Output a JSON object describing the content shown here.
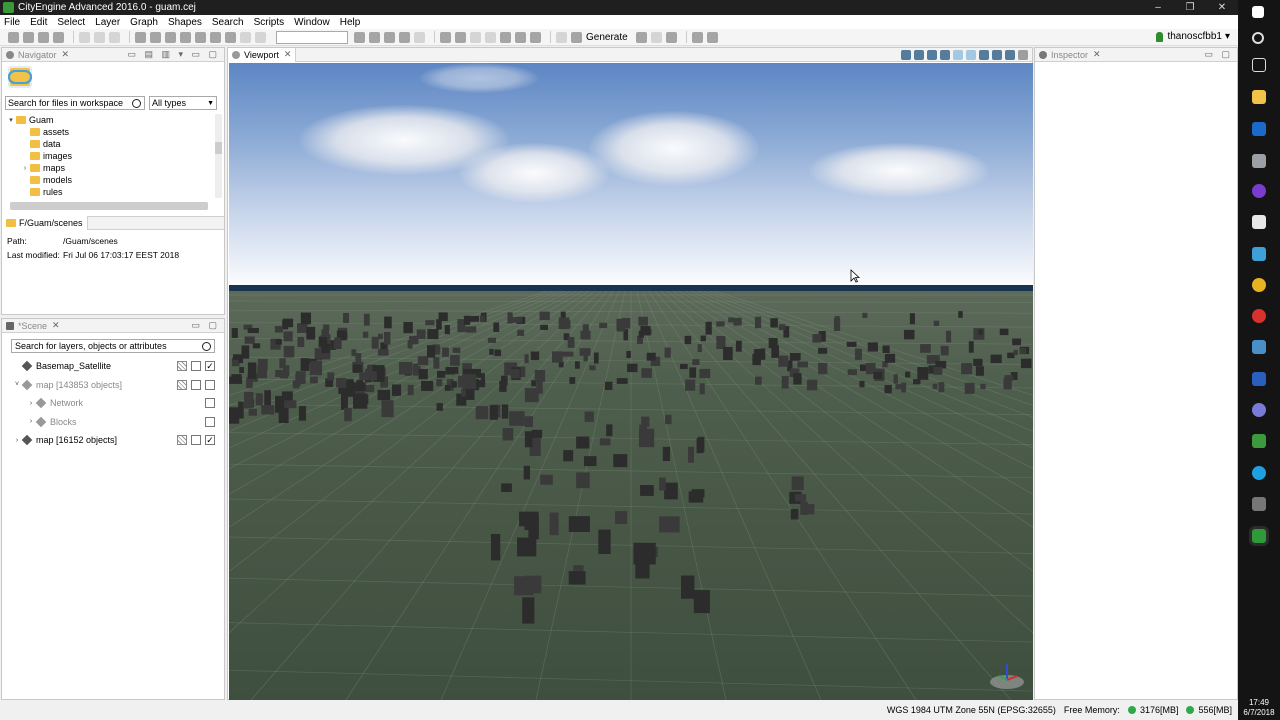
{
  "window": {
    "title": "CityEngine Advanced 2016.0 - guam.cej",
    "controls": [
      "–",
      "❐",
      "✕"
    ]
  },
  "menu": [
    "File",
    "Edit",
    "Select",
    "Layer",
    "Graph",
    "Shapes",
    "Search",
    "Scripts",
    "Window",
    "Help"
  ],
  "toolbar": {
    "generate_label": "Generate",
    "user": "thanoscfbb1",
    "user_caret": "▾"
  },
  "navigator": {
    "tab_label": "Navigator",
    "search_placeholder": "Search for files in workspace",
    "type_filter": "All types",
    "tree": [
      {
        "label": "Guam",
        "twisty": "▾",
        "level": 0
      },
      {
        "label": "assets",
        "twisty": "",
        "level": 1
      },
      {
        "label": "data",
        "twisty": "",
        "level": 1
      },
      {
        "label": "images",
        "twisty": "",
        "level": 1
      },
      {
        "label": "maps",
        "twisty": "›",
        "level": 1
      },
      {
        "label": "models",
        "twisty": "",
        "level": 1
      },
      {
        "label": "rules",
        "twisty": "",
        "level": 1
      }
    ],
    "path_tab": "F/Guam/scenes",
    "info": {
      "path_key": "Path:",
      "path_value": "/Guam/scenes",
      "modified_key": "Last modified:",
      "modified_value": "Fri Jul 06 17:03:17 EEST 2018"
    }
  },
  "scene": {
    "tab_label": "*Scene",
    "search_placeholder": "Search for layers, objects or attributes",
    "layers": [
      {
        "label": "Basemap_Satellite",
        "twisty": "",
        "dim": false,
        "checked": "✓"
      },
      {
        "label": "map [143853 objects]",
        "twisty": "˅",
        "dim": true,
        "checked": ""
      },
      {
        "label": "Network",
        "twisty": "›",
        "dim": true,
        "checked": ""
      },
      {
        "label": "Blocks",
        "twisty": "›",
        "dim": true,
        "checked": ""
      },
      {
        "label": "map [16152 objects]",
        "twisty": "›",
        "dim": false,
        "checked": "✓"
      }
    ]
  },
  "viewport": {
    "tab_label": "Viewport"
  },
  "inspector": {
    "tab_label": "Inspector"
  },
  "status": {
    "crs": "WGS 1984 UTM Zone 55N (EPSG:32655)",
    "free_memory_label": "Free Memory:",
    "memory_1": "3176[MB]",
    "memory_2": "556[MB]"
  },
  "clock": {
    "time": "17:49",
    "date": "6/7/2018"
  }
}
